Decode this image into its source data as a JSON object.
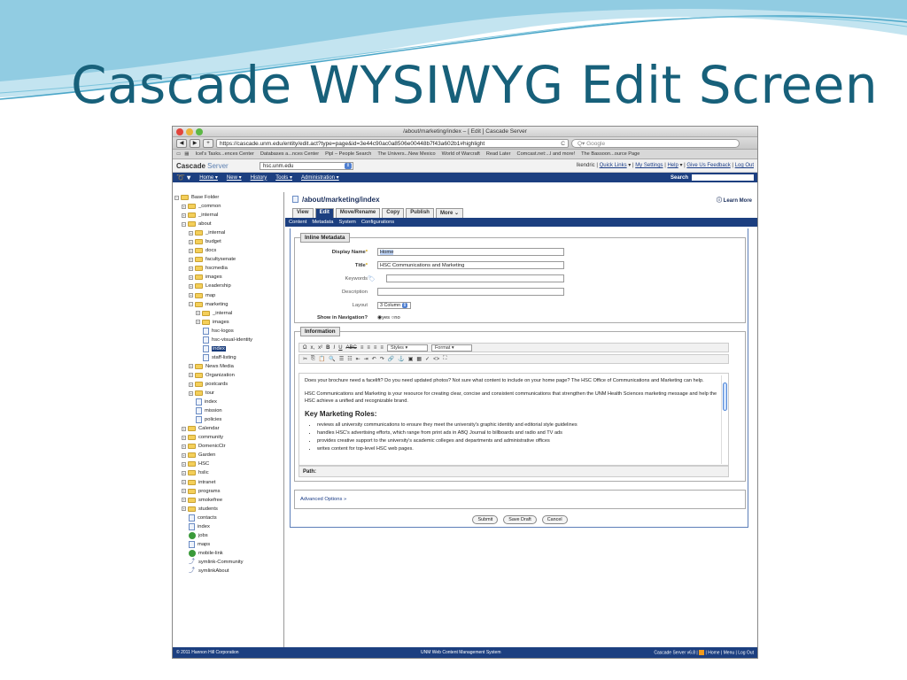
{
  "slide": {
    "title": "Cascade WYSIWYG Edit Screen"
  },
  "browser": {
    "window_title": "/about/marketing/index – [ Edit ] Cascade Server",
    "url": "https://cascade.unm.edu/entity/edit.act?type=page&id=3e44c90ac0a8506e00448b7f43a602b1#highlight",
    "search_placeholder": "Q▾ Google",
    "bookmarks": [
      "Icel's Tasks...ences Center",
      "Databases a...nces Center",
      "Pipl – People Search",
      "The Univers...New Mexico",
      "World of Warcraft",
      "Read Later",
      "Comcast.net:...l and more!",
      "The Bassoon...ource Page"
    ]
  },
  "cascade": {
    "logo_bold": "Cascade",
    "logo_rest": " Server",
    "site": "hsc.unm.edu",
    "user": "lkendric",
    "quick_links": "Quick Links",
    "my_settings": "My Settings",
    "help": "Help",
    "feedback": "Give Us Feedback",
    "logout": "Log Out",
    "nav": [
      "Home",
      "New",
      "History",
      "Tools",
      "Administration"
    ],
    "search_label": "Search"
  },
  "tree": [
    {
      "label": "Base Folder",
      "level": 0,
      "type": "folder",
      "exp": "−"
    },
    {
      "label": "_common",
      "level": 1,
      "type": "folder",
      "exp": "+"
    },
    {
      "label": "_internal",
      "level": 1,
      "type": "folder",
      "exp": "+"
    },
    {
      "label": "about",
      "level": 1,
      "type": "folder",
      "exp": "−"
    },
    {
      "label": "_internal",
      "level": 2,
      "type": "folder",
      "exp": "+"
    },
    {
      "label": "budget",
      "level": 2,
      "type": "folder",
      "exp": "+"
    },
    {
      "label": "docs",
      "level": 2,
      "type": "folder",
      "exp": "+"
    },
    {
      "label": "facultysenate",
      "level": 2,
      "type": "folder",
      "exp": "+"
    },
    {
      "label": "hscmedia",
      "level": 2,
      "type": "folder",
      "exp": "+"
    },
    {
      "label": "images",
      "level": 2,
      "type": "folder",
      "exp": "+"
    },
    {
      "label": "Leadership",
      "level": 2,
      "type": "folder",
      "exp": "+"
    },
    {
      "label": "map",
      "level": 2,
      "type": "folder",
      "exp": "+"
    },
    {
      "label": "marketing",
      "level": 2,
      "type": "folder",
      "exp": "−"
    },
    {
      "label": "_internal",
      "level": 3,
      "type": "folder",
      "exp": "+"
    },
    {
      "label": "images",
      "level": 3,
      "type": "folder",
      "exp": "+"
    },
    {
      "label": "hsc-logos",
      "level": 4,
      "type": "page"
    },
    {
      "label": "hsc-visual-identity",
      "level": 4,
      "type": "page"
    },
    {
      "label": "index",
      "level": 4,
      "type": "page",
      "selected": true
    },
    {
      "label": "staff-listing",
      "level": 4,
      "type": "page"
    },
    {
      "label": "News Media",
      "level": 2,
      "type": "folder",
      "exp": "+"
    },
    {
      "label": "Organization",
      "level": 2,
      "type": "folder",
      "exp": "+"
    },
    {
      "label": "postcards",
      "level": 2,
      "type": "folder",
      "exp": "+"
    },
    {
      "label": "tour",
      "level": 2,
      "type": "folder",
      "exp": "+"
    },
    {
      "label": "index",
      "level": 3,
      "type": "page"
    },
    {
      "label": "mission",
      "level": 3,
      "type": "page"
    },
    {
      "label": "policies",
      "level": 3,
      "type": "page"
    },
    {
      "label": "Calendar",
      "level": 1,
      "type": "folder",
      "exp": "+"
    },
    {
      "label": "community",
      "level": 1,
      "type": "folder",
      "exp": "+"
    },
    {
      "label": "DomenicCtr",
      "level": 1,
      "type": "folder",
      "exp": "+"
    },
    {
      "label": "Garden",
      "level": 1,
      "type": "folder",
      "exp": "+"
    },
    {
      "label": "HSC",
      "level": 1,
      "type": "folder",
      "exp": "+"
    },
    {
      "label": "hslic",
      "level": 1,
      "type": "folder",
      "exp": "+"
    },
    {
      "label": "intranet",
      "level": 1,
      "type": "folder",
      "exp": "+"
    },
    {
      "label": "programs",
      "level": 1,
      "type": "folder",
      "exp": "+"
    },
    {
      "label": "smokefree",
      "level": 1,
      "type": "folder",
      "exp": "+"
    },
    {
      "label": "students",
      "level": 1,
      "type": "folder",
      "exp": "+"
    },
    {
      "label": "contacts",
      "level": 2,
      "type": "page"
    },
    {
      "label": "index",
      "level": 2,
      "type": "page"
    },
    {
      "label": "jobs",
      "level": 2,
      "type": "globe"
    },
    {
      "label": "maps",
      "level": 2,
      "type": "page"
    },
    {
      "label": "mobile-link",
      "level": 2,
      "type": "globe"
    },
    {
      "label": "symlink-Community",
      "level": 2,
      "type": "sym"
    },
    {
      "label": "symlinkAbout",
      "level": 2,
      "type": "sym"
    }
  ],
  "page": {
    "path": "/about/marketing/index",
    "learn_more": "Learn More",
    "tabs": [
      "View",
      "Edit",
      "Move/Rename",
      "Copy",
      "Publish",
      "More"
    ],
    "subtabs": [
      "Content",
      "Metadata",
      "System",
      "Configurations"
    ],
    "inline_metadata_legend": "Inline Metadata",
    "fields": {
      "display_name_label": "Display Name",
      "display_name": "Home",
      "title_label": "Title",
      "title": "HSC Communications and Marketing",
      "keywords_label": "Keywords",
      "description_label": "Description",
      "layout_label": "Layout",
      "layout": "3 Column",
      "show_nav_label": "Show in Navigation?",
      "yes": "yes",
      "no": "no"
    },
    "information_legend": "Information",
    "toolbar": {
      "styles": "Styles",
      "format": "Format"
    },
    "editor": {
      "p1": "Does your brochure need a facelift? Do you need updated photos?  Not sure what content to include on your home page? The HSC Office of Communications and Marketing can help.",
      "p2": "HSC Communications and Marketing is your resource for creating clear, concise and consistent communications that strengthen the UNM Health Sciences marketing message and help the HSC achieve a unified and recognizable brand.",
      "heading": "Key Marketing Roles:",
      "bullets": [
        "reviews all university communications to ensure they meet the university's graphic identity and editorial style guidelines",
        "handles HSC's  advertising efforts, which range from print ads in ABQ Journal to billboards and radio and TV ads",
        "provides creative support to the university's academic colleges and departments and administrative offices",
        "writes content  for top-level HSC web pages."
      ]
    },
    "path_label": "Path:",
    "advanced": "Advanced Options »",
    "buttons": [
      "Submit",
      "Save Draft",
      "Cancel"
    ]
  },
  "footer": {
    "left": "© 2011 Hannon Hill Corporation",
    "center": "UNM Web Content Management System",
    "right": "Cascade Server v6.8 | ",
    "links": "| Home | Menu | Log Out"
  }
}
